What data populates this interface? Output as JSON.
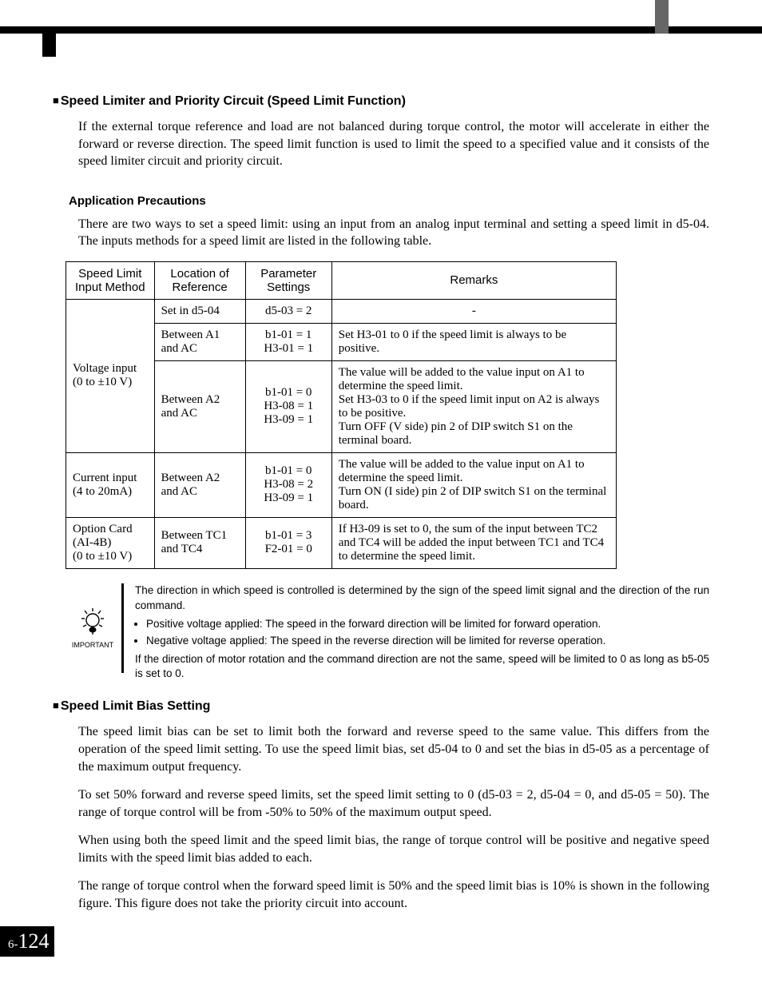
{
  "page_number_prefix": "6-",
  "page_number": "124",
  "section1": {
    "title": "Speed Limiter and Priority Circuit (Speed Limit Function)",
    "intro": "If the external torque reference and load are not balanced during torque control, the motor will accelerate in either the forward or reverse direction. The speed limit function is used to limit the speed to a specified value and it consists of the speed limiter circuit and priority circuit.",
    "precautions_title": "Application Precautions",
    "precautions_intro": "There are two ways to set a speed limit: using an input from an analog input terminal and setting a speed limit in d5-04. The inputs methods for a speed limit are listed in the following table."
  },
  "table": {
    "headers": {
      "c1": "Speed Limit Input Method",
      "c2": "Location of Reference",
      "c3": "Parameter Settings",
      "c4": "Remarks"
    },
    "rows": [
      {
        "method": "Voltage input (0 to ±10 V)",
        "loc": "Set in d5-04",
        "param": "d5-03 = 2",
        "remarks": "-",
        "rowspan_method": 3,
        "center_remarks": true
      },
      {
        "loc": "Between A1 and AC",
        "param": "b1-01 = 1\nH3-01 = 1",
        "remarks": "Set H3-01 to 0 if the speed limit is always to be positive."
      },
      {
        "loc": "Between A2 and AC",
        "param": "b1-01 = 0\nH3-08 = 1\nH3-09 = 1",
        "remarks": "The value will be added to the value input on A1 to determine the speed limit.\nSet H3-03 to 0 if the speed limit input on A2 is always to be positive.\nTurn OFF (V side) pin 2 of DIP switch S1 on the terminal board."
      },
      {
        "method": "Current input (4 to 20mA)",
        "loc": "Between A2 and AC",
        "param": "b1-01 = 0\nH3-08 = 2\nH3-09 = 1",
        "remarks": "The value will be added to the value input on A1 to determine the speed limit.\nTurn ON (I side) pin 2 of DIP switch S1 on the terminal board."
      },
      {
        "method": "Option Card (AI-4B)\n(0 to ±10 V)",
        "loc": "Between TC1 and TC4",
        "param": "b1-01 = 3\nF2-01 = 0",
        "remarks": "If H3-09 is set to 0, the sum of the input between TC2 and TC4 will be added the input between TC1 and TC4 to determine the speed limit."
      }
    ]
  },
  "important": {
    "label": "IMPORTANT",
    "line1": "The direction in which speed is controlled is determined by the sign of the speed limit signal and the direction of the run command.",
    "bullet1": "Positive voltage applied: The speed in the forward direction will be limited for forward operation.",
    "bullet2": "Negative voltage applied: The speed in the reverse direction will be limited for reverse operation.",
    "line2": "If the direction of motor rotation and the command direction are not the same, speed will be limited to 0 as long as b5-05 is set to 0."
  },
  "section2": {
    "title": "Speed Limit Bias Setting",
    "p1": "The speed limit bias can be set to limit both the forward and reverse speed to the same value. This differs from the operation of the speed limit setting. To use the speed limit bias, set d5-04 to 0 and set the bias in d5-05 as a percentage of the maximum output frequency.",
    "p2": "To set 50% forward and reverse speed limits, set the speed limit setting to 0 (d5-03 = 2, d5-04 = 0, and d5-05 = 50). The range of torque control will be from -50% to 50% of the maximum output speed.",
    "p3": "When using both the speed limit and the speed limit bias, the range of torque control will be positive and negative speed limits with the speed limit bias added to each.",
    "p4": "The range of torque control when the forward speed limit is 50% and the speed limit bias is 10% is shown in the following figure. This figure does not take the priority circuit into account."
  }
}
